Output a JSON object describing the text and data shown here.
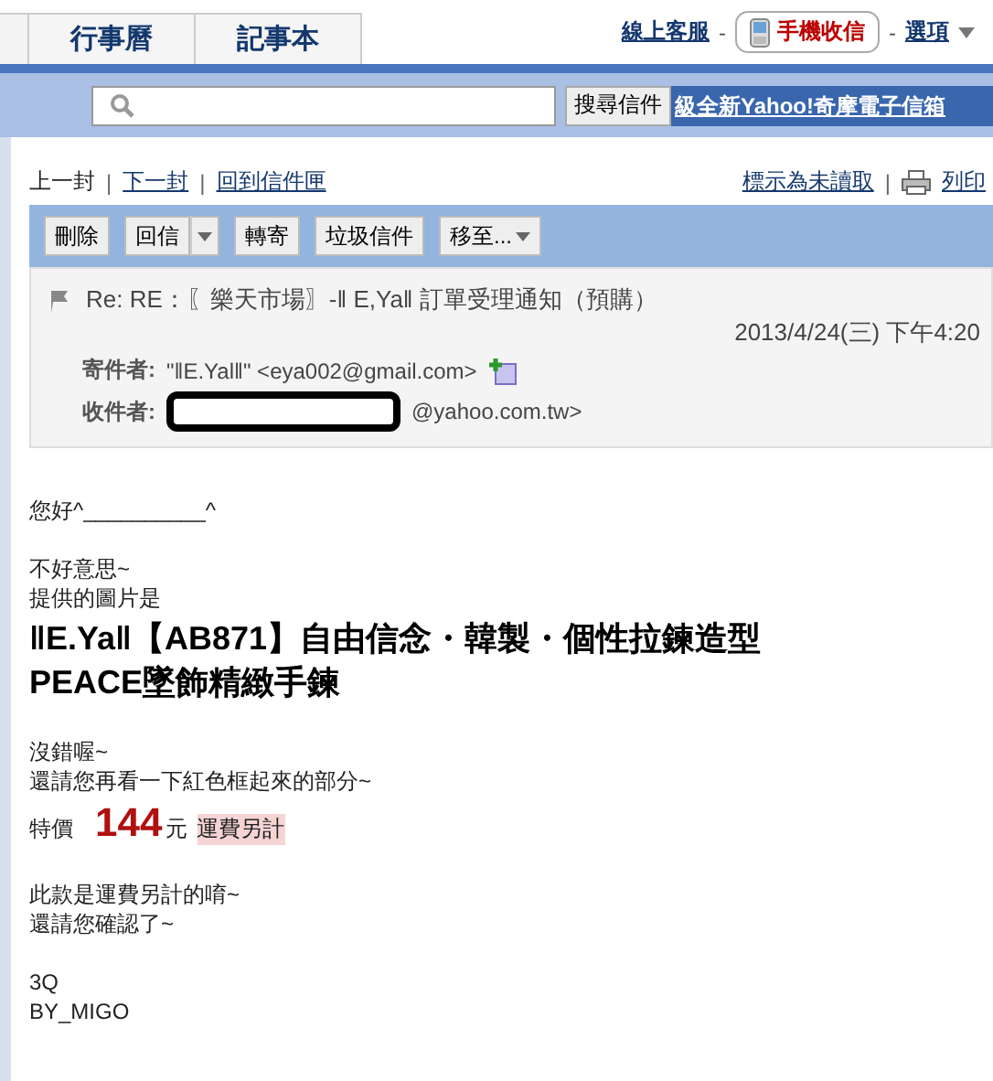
{
  "tabs": [
    {
      "label": "行事曆"
    },
    {
      "label": "記事本"
    }
  ],
  "top_links": {
    "support": "線上客服",
    "separator_1": "-",
    "mobile": "手機收信",
    "separator_2": "-",
    "options": "選項"
  },
  "search": {
    "button": "搜尋信件",
    "promo": "級全新Yahoo!奇摩電子信箱"
  },
  "nav": {
    "previous": "上一封",
    "divider_1": "|",
    "next": "下一封",
    "divider_2": "|",
    "back": "回到信件匣",
    "mark_unread": "標示為未讀取",
    "divider_3": "|",
    "print": "列印"
  },
  "toolbar": [
    {
      "label": "刪除",
      "kind": "plain"
    },
    {
      "label": "回信",
      "kind": "split"
    },
    {
      "label": "轉寄",
      "kind": "plain"
    },
    {
      "label": "垃圾信件",
      "kind": "plain"
    },
    {
      "label": "移至...",
      "kind": "menu"
    }
  ],
  "message": {
    "subject": "Re: RE：〖樂天市場〗-‖ E,Ya‖ 訂單受理通知（預購）",
    "date": "2013/4/24(三) 下午4:20",
    "from_label": "寄件者:",
    "from": "\"‖E.Yal‖\" <eya002@gmail.com>",
    "to_label": "收件者:",
    "to": "@yahoo.com.tw>"
  },
  "body": [
    {
      "kind": "line",
      "text": "您好^__________^"
    },
    {
      "kind": "gap"
    },
    {
      "kind": "line",
      "text": "不好意思~"
    },
    {
      "kind": "line",
      "text": "提供的圖片是"
    },
    {
      "kind": "title",
      "text": "‖E.Ya‖【AB871】自由信念・韓製・個性拉鍊造型PEACE墜飾精緻手鍊"
    },
    {
      "kind": "gap"
    },
    {
      "kind": "line",
      "text": "沒錯喔~"
    },
    {
      "kind": "line",
      "text": "還請您再看一下紅色框起來的部分~"
    },
    {
      "kind": "price",
      "label": "特價",
      "amount": "144",
      "unit": "元",
      "note": "運費另計"
    },
    {
      "kind": "gap"
    },
    {
      "kind": "line",
      "text": "此款是運費另計的唷~"
    },
    {
      "kind": "line",
      "text": "還請您確認了~"
    },
    {
      "kind": "gap"
    },
    {
      "kind": "line",
      "text": "3Q"
    },
    {
      "kind": "line",
      "text": "BY_MIGO"
    }
  ]
}
